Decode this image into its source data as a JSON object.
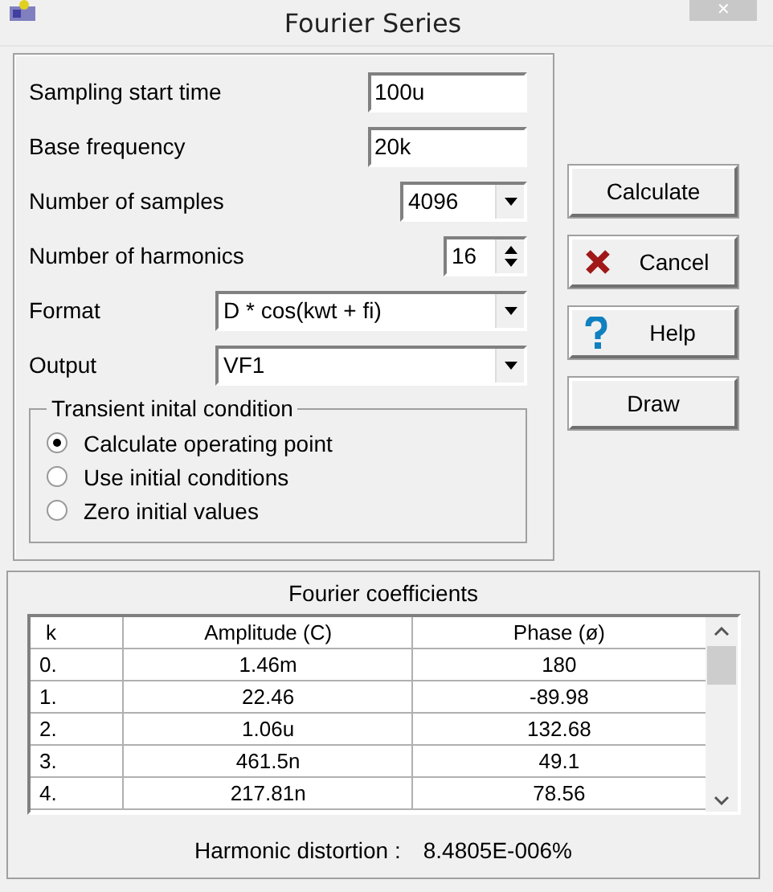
{
  "window": {
    "title": "Fourier Series",
    "close": "✕"
  },
  "fields": [
    {
      "kind": "text",
      "label": "Sampling start time",
      "value": "100u"
    },
    {
      "kind": "text",
      "label": "Base frequency",
      "value": "20k"
    },
    {
      "kind": "dropdown",
      "label": "Number of samples",
      "value": "4096"
    },
    {
      "kind": "spinner",
      "label": "Number of harmonics",
      "value": "16"
    },
    {
      "kind": "combo",
      "label": "Format",
      "value": "D * cos(kwt + fi)"
    },
    {
      "kind": "combo",
      "label": "Output",
      "value": "VF1"
    }
  ],
  "transient": {
    "title": "Transient inital condition",
    "options": [
      {
        "label": "Calculate operating point",
        "selected": true
      },
      {
        "label": "Use initial conditions",
        "selected": false
      },
      {
        "label": "Zero initial values",
        "selected": false
      }
    ]
  },
  "buttons": [
    {
      "kind": "plain",
      "label": "Calculate"
    },
    {
      "kind": "cancel",
      "label": "Cancel"
    },
    {
      "kind": "help",
      "label": "Help"
    },
    {
      "kind": "plain",
      "label": "Draw"
    }
  ],
  "coefficients": {
    "title": "Fourier coefficients",
    "columns": [
      "k",
      "Amplitude (C)",
      "Phase (ø)"
    ],
    "rows": [
      [
        "0.",
        "1.46m",
        "180"
      ],
      [
        "1.",
        "22.46",
        "-89.98"
      ],
      [
        "2.",
        "1.06u",
        "132.68"
      ],
      [
        "3.",
        "461.5n",
        "49.1"
      ],
      [
        "4.",
        "217.81n",
        "78.56"
      ]
    ],
    "distortion_label": "Harmonic distortion :",
    "distortion_value": "8.4805E-006%"
  }
}
